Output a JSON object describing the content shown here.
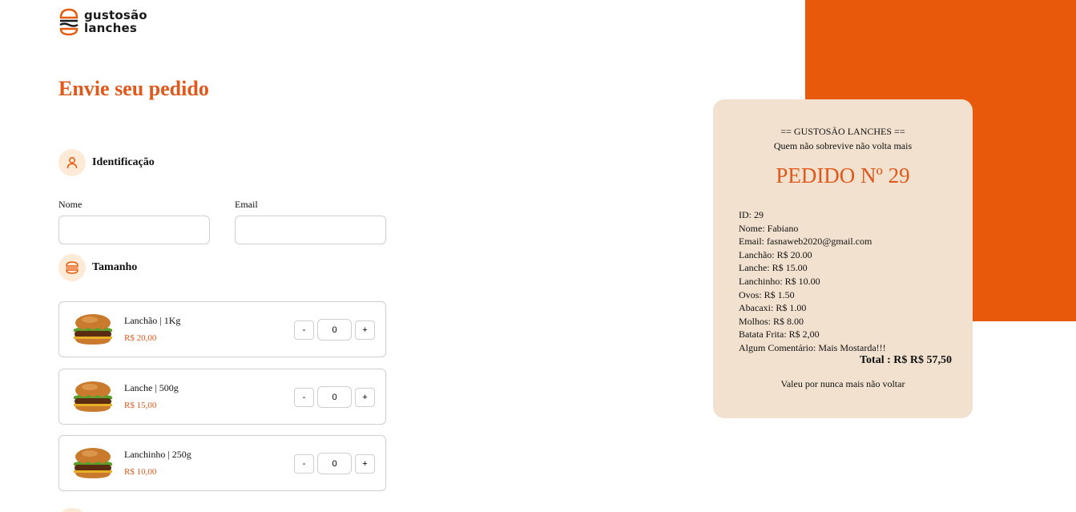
{
  "brand": {
    "line1": "gustosão",
    "line2": "lanches"
  },
  "page_title": "Envie seu pedido",
  "sections": {
    "identification": "Identificação",
    "size": "Tamanho"
  },
  "form": {
    "name_label": "Nome",
    "name_value": "",
    "email_label": "Email",
    "email_value": ""
  },
  "products": [
    {
      "name": "Lanchão | 1Kg",
      "price": "R$ 20,00",
      "qty": "0",
      "minus": "-",
      "plus": "+"
    },
    {
      "name": "Lanche | 500g",
      "price": "R$ 15,00",
      "qty": "0",
      "minus": "-",
      "plus": "+"
    },
    {
      "name": "Lanchinho | 250g",
      "price": "R$ 10,00",
      "qty": "0",
      "minus": "-",
      "plus": "+"
    }
  ],
  "receipt": {
    "header": "== GUSTOSÃO LANCHES ==",
    "tagline": "Quem não sobrevive não volta mais",
    "order_title": "PEDIDO Nº 29",
    "lines": [
      "ID: 29",
      "Nome: Fabiano",
      "Email: fasnaweb2020@gmail.com",
      "Lanchão: R$ 20.00",
      "Lanche: R$ 15.00",
      "Lanchinho: R$ 10.00",
      "Ovos: R$ 1.50",
      "Abacaxi: R$ 1.00",
      "Molhos: R$ 8.00",
      "Batata Frita: R$ 2,00",
      "Algum Comentário: Mais Mostarda!!!"
    ],
    "total": "Total : R$ R$ 57,50",
    "footer": "Valeu por nunca mais não voltar"
  },
  "colors": {
    "accent": "#e8590c",
    "receipt_bg": "#f2e1cf",
    "icon_bg": "#fdebd8"
  },
  "icons": {
    "brand": "burger-icon",
    "identification": "user-icon",
    "size": "burger-icon"
  }
}
